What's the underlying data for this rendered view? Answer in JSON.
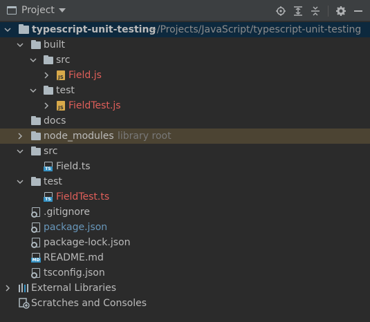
{
  "header": {
    "title": "Project",
    "icons": [
      "project-view-icon",
      "locate-icon",
      "expand-all-icon",
      "collapse-all-icon",
      "settings-gear-icon",
      "hide-icon"
    ]
  },
  "tree": {
    "root": {
      "name": "typescript-unit-testing",
      "path": "~/Projects/JavaScript/typescript-unit-testing"
    },
    "items": [
      {
        "label": "built"
      },
      {
        "label": "src"
      },
      {
        "label": "Field.js"
      },
      {
        "label": "test"
      },
      {
        "label": "FieldTest.js"
      },
      {
        "label": "docs"
      },
      {
        "label": "node_modules",
        "suffix": "library root"
      },
      {
        "label": "src"
      },
      {
        "label": "Field.ts"
      },
      {
        "label": "test"
      },
      {
        "label": "FieldTest.ts"
      },
      {
        "label": ".gitignore"
      },
      {
        "label": "package.json"
      },
      {
        "label": "package-lock.json"
      },
      {
        "label": "README.md"
      },
      {
        "label": "tsconfig.json"
      },
      {
        "label": "External Libraries"
      },
      {
        "label": "Scratches and Consoles"
      }
    ],
    "file_badges": {
      "js": "JS",
      "ts": "TS",
      "md": "MD"
    },
    "colors": {
      "modified": "#e05f5a",
      "changed": "#6897bb",
      "excluded_bg": "#4c4433",
      "selected_bg": "#0d293e"
    }
  }
}
